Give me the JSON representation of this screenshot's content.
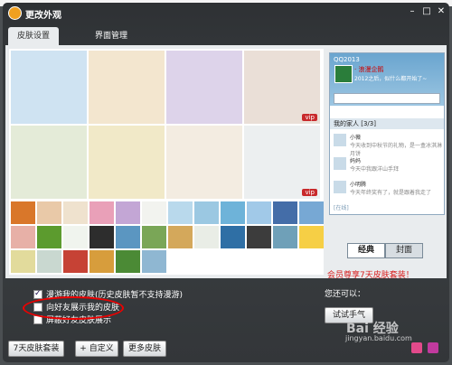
{
  "window": {
    "title": "更改外观"
  },
  "tabs": [
    {
      "label": "皮肤设置"
    },
    {
      "label": "界面管理"
    }
  ],
  "big_skins": [
    {
      "name": "sky-skin",
      "vip": ""
    },
    {
      "name": "flower-girl-skin",
      "vip": ""
    },
    {
      "name": "girl-sitting-skin",
      "vip": ""
    },
    {
      "name": "pagoda-skin",
      "vip": "vip"
    },
    {
      "name": "swing-skin",
      "vip": ""
    },
    {
      "name": "kitten-cup-skin",
      "vip": ""
    },
    {
      "name": "boat-skin",
      "vip": ""
    },
    {
      "name": "ink-tower-skin",
      "vip": "vip"
    }
  ],
  "small_colors": [
    "#d9772a",
    "#e9c9a8",
    "#efe2ce",
    "#e9a0b8",
    "#c3a6d5",
    "#f2f3ef",
    "#b9d9ec",
    "#9bc8e2",
    "#6eb3d9",
    "#a1c9e8",
    "#446da8",
    "#77a8d4",
    "#e7b0a7",
    "#5c9b2e",
    "#f0f4ee",
    "#2d2d2d",
    "#5b96c1",
    "#7aa657",
    "#d4a85b",
    "#e9ede6",
    "#2f6fa5",
    "#3c3c3c",
    "#6fa0b8",
    "#f6cf45",
    "#e2db9c",
    "#c9d8d0",
    "#c64235",
    "#d79d3c",
    "#4b8a35",
    "#8fb7d2"
  ],
  "preview": {
    "title": "QQ2013",
    "name": "· 浪漫企鹅",
    "signature": "2012之后，似什么都开始了~",
    "group": "我的家人 [3/3]",
    "contacts": [
      {
        "name": "小薇",
        "status": "今天收到中秋节的礼物，是一盒冰淇淋月饼"
      },
      {
        "name": "妈妈",
        "status": "今天中我跟洋山手拜"
      },
      {
        "name": "小明腾",
        "status": "今天年终奖有了，就是跟着我走了"
      }
    ],
    "footer": "[在线]"
  },
  "segment": {
    "classic": "经典",
    "cover": "封面"
  },
  "promo": "会员尊享7天皮肤套装！",
  "options": [
    {
      "label": "漫游我的皮肤(历史皮肤暂不支持漫游)",
      "checked": true
    },
    {
      "label": "向好友展示我的皮肤",
      "checked": false
    },
    {
      "label": "屏蔽好友皮肤展示",
      "checked": false
    }
  ],
  "side": {
    "label": "您还可以：",
    "try_button": "试试手气"
  },
  "buttons": {
    "seven_day": "7天皮肤套装",
    "custom": "+ 自定义",
    "more": "更多皮肤"
  },
  "watermark": {
    "main": "Bai 经验",
    "url": "jingyan.baidu.com"
  }
}
